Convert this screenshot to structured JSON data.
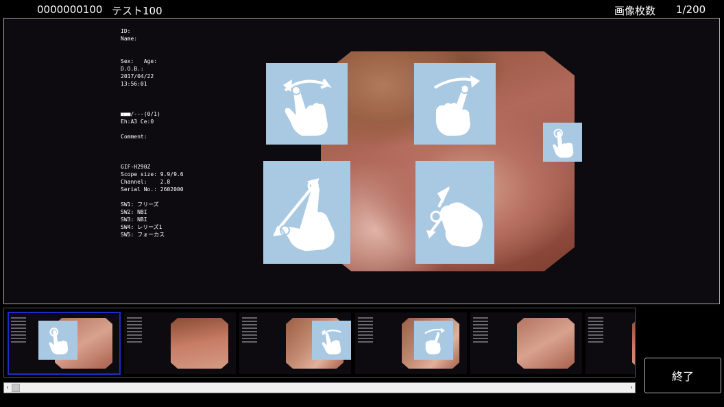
{
  "header": {
    "patient_id": "0000000100",
    "patient_name": "テスト100",
    "image_count_label": "画像枚数",
    "image_count_value": "1/200"
  },
  "info_panel": {
    "lines": [
      "ID:",
      "Name:",
      "",
      "",
      "Sex:   Age:",
      "D.O.B.:",
      "2017/04/22",
      "13:56:01",
      "",
      "",
      "",
      "■■■/---(0/1)",
      "Eh:A3 Ce:0",
      "",
      "Comment:",
      "",
      "",
      "",
      "GIF-H290Z",
      "Scope size: 9.9/9.6",
      "Channel:    2.8",
      "Serial No.: 2602000",
      "",
      "SW1: フリーズ",
      "SW2: NBI",
      "SW3: NBI",
      "SW4: レリーズ1",
      "SW5: フォーカス"
    ]
  },
  "gestures": [
    {
      "name": "swipe-left-gesture-icon"
    },
    {
      "name": "swipe-right-gesture-icon"
    },
    {
      "name": "tap-gesture-icon"
    },
    {
      "name": "pinch-out-gesture-icon"
    },
    {
      "name": "pinch-in-gesture-icon"
    }
  ],
  "thumbnails": {
    "count": 6,
    "selected_index": 0
  },
  "end_button": {
    "label": "終了"
  },
  "colors": {
    "background": "#000000",
    "viewer_background": "#0d0b10",
    "gesture_tile": "#a9c9e3",
    "selection": "#1a2ccc"
  }
}
